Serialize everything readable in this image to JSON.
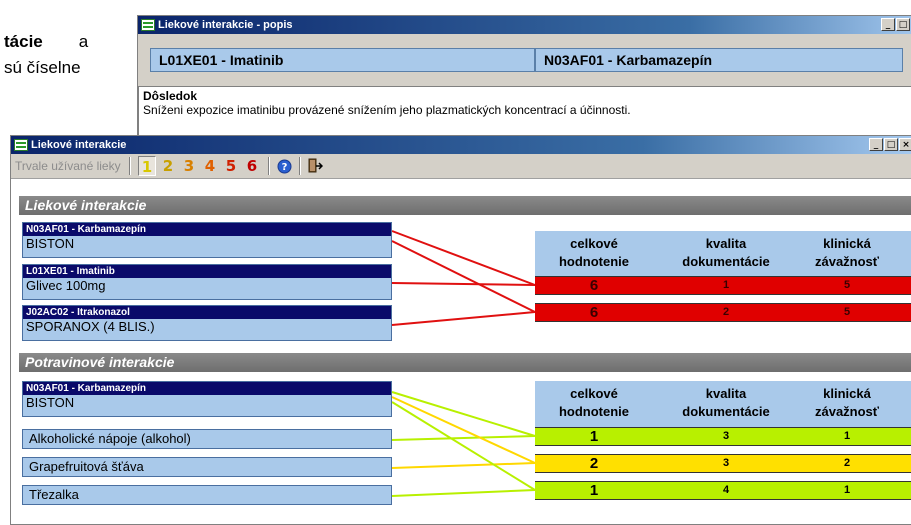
{
  "background_doc": {
    "line1_bold": "tácie",
    "line1_rest": "a",
    "line2": "sú číselne"
  },
  "popup": {
    "title": "Liekové interakcie - popis",
    "drug_left": "L01XE01 - Imatinib",
    "drug_right": "N03AF01 - Karbamazepín",
    "consequence_label": "Dôsledok",
    "consequence_text": "Sníženi expozice imatinibu provázené snížením jeho plazmatických koncentrací a účinnosti."
  },
  "main": {
    "title": "Liekové interakcie",
    "toolbar": {
      "long_term_label": "Trvale užívané lieky",
      "levels": [
        {
          "label": "1",
          "color": "#d8c800"
        },
        {
          "label": "2",
          "color": "#c8a000"
        },
        {
          "label": "3",
          "color": "#d88000"
        },
        {
          "label": "4",
          "color": "#e06000"
        },
        {
          "label": "5",
          "color": "#d02000"
        },
        {
          "label": "6",
          "color": "#c00000"
        }
      ],
      "help_icon": "help-icon",
      "exit_icon": "exit-icon"
    },
    "drug_section": {
      "title": "Liekové interakcie",
      "drugs": [
        {
          "code": "N03AF01 - Karbamazepín",
          "name": "BISTON"
        },
        {
          "code": "L01XE01 - Imatinib",
          "name": "Glivec 100mg"
        },
        {
          "code": "J02AC02 - Itrakonazol",
          "name": "SPORANOX (4 BLIS.)"
        }
      ],
      "headers": [
        "celkové hodnotenie",
        "kvalita dokumentácie",
        "klinická závažnosť"
      ],
      "rows": [
        {
          "overall": "6",
          "quality": "1",
          "severity": "5",
          "color": "#e00000",
          "text_color": "#3a0000"
        },
        {
          "overall": "6",
          "quality": "2",
          "severity": "5",
          "color": "#e00000",
          "text_color": "#3a0000"
        }
      ],
      "line_color": "#e01010"
    },
    "food_section": {
      "title": "Potravinové interakcie",
      "drug": {
        "code": "N03AF01 - Karbamazepín",
        "name": "BISTON"
      },
      "foods": [
        "Alkoholické nápoje (alkohol)",
        "Grapefruitová šťáva",
        "Třezalka"
      ],
      "headers": [
        "celkové hodnotenie",
        "kvalita dokumentácie",
        "klinická závažnosť"
      ],
      "rows": [
        {
          "overall": "1",
          "quality": "3",
          "severity": "1",
          "color": "#b8f000",
          "line": "#b8f000"
        },
        {
          "overall": "2",
          "quality": "3",
          "severity": "2",
          "color": "#ffe000",
          "line": "#ffd800"
        },
        {
          "overall": "1",
          "quality": "4",
          "severity": "1",
          "color": "#b8f000",
          "line": "#b8f000"
        }
      ]
    }
  }
}
